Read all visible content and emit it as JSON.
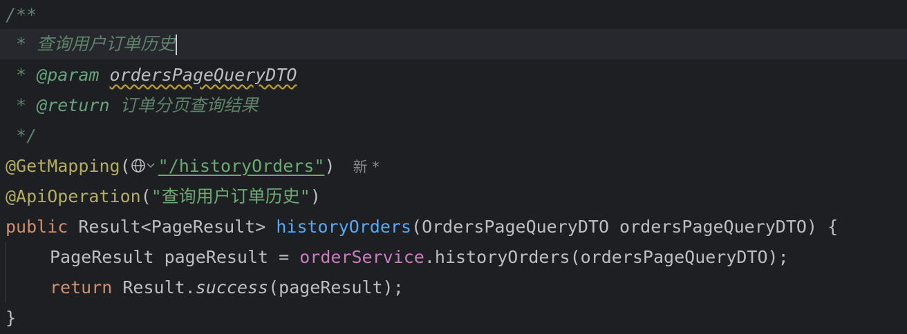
{
  "code": {
    "doc_open": "/**",
    "doc_star": " * ",
    "doc_summary": "查询用户订单历史",
    "param_tag": "@param",
    "param_name": "ordersPageQueryDTO",
    "return_tag": "@return",
    "return_desc": "订单分页查询结果",
    "doc_close": " */",
    "get_mapping": "@GetMapping",
    "paren_open": "(",
    "mapping_path": "\"/historyOrders\"",
    "paren_close": ")",
    "hint_new": "新 *",
    "api_operation": "@ApiOperation",
    "api_value": "\"查询用户订单历史\"",
    "kw_public": "public",
    "return_type": " Result<PageResult> ",
    "method_name": "historyOrders",
    "method_params": "(OrdersPageQueryDTO ordersPageQueryDTO) {",
    "line9_type": "PageResult pageResult = ",
    "service_field": "orderService",
    "line9_call": ".historyOrders(ordersPageQueryDTO);",
    "kw_return": "return",
    "result_class": " Result.",
    "success_method": "success",
    "return_args": "(pageResult);",
    "brace_close": "}"
  },
  "colors": {
    "background": "#1e1f22",
    "current_line": "#26282e",
    "keyword": "#cf8e6d",
    "method": "#56a8f5",
    "annotation": "#b3ae60",
    "string": "#6aab73",
    "field": "#c77dbb",
    "doc_comment": "#5f826b"
  },
  "icons": {
    "url_icon": "globe-icon",
    "dropdown_icon": "chevron-down-icon"
  }
}
